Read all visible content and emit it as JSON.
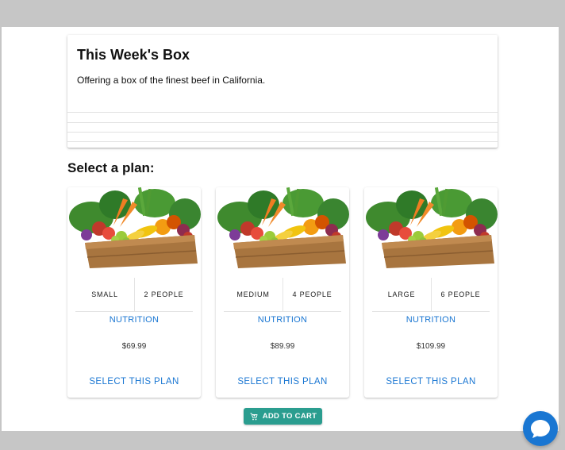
{
  "week_box": {
    "title": "This Week's Box",
    "description": "Offering a box of the finest beef in California."
  },
  "select_plan_title": "Select a plan:",
  "plans": [
    {
      "size": "SMALL",
      "people": "2 PEOPLE",
      "nutrition_label": "NUTRITION",
      "price": "$69.99",
      "select_label": "SELECT THIS PLAN",
      "image": "vegetable-box-image"
    },
    {
      "size": "MEDIUM",
      "people": "4 PEOPLE",
      "nutrition_label": "NUTRITION",
      "price": "$89.99",
      "select_label": "SELECT THIS PLAN",
      "image": "vegetable-box-image"
    },
    {
      "size": "LARGE",
      "people": "6 PEOPLE",
      "nutrition_label": "NUTRITION",
      "price": "$109.99",
      "select_label": "SELECT THIS PLAN",
      "image": "vegetable-box-image"
    }
  ],
  "cart": {
    "label": "ADD TO CART",
    "icon": "add-shopping-cart-icon"
  },
  "chat": {
    "icon": "chat-bubble-icon"
  },
  "colors": {
    "accent": "#1976d2",
    "cart_button": "#2a9d8f",
    "chat_button": "#1976d2"
  }
}
